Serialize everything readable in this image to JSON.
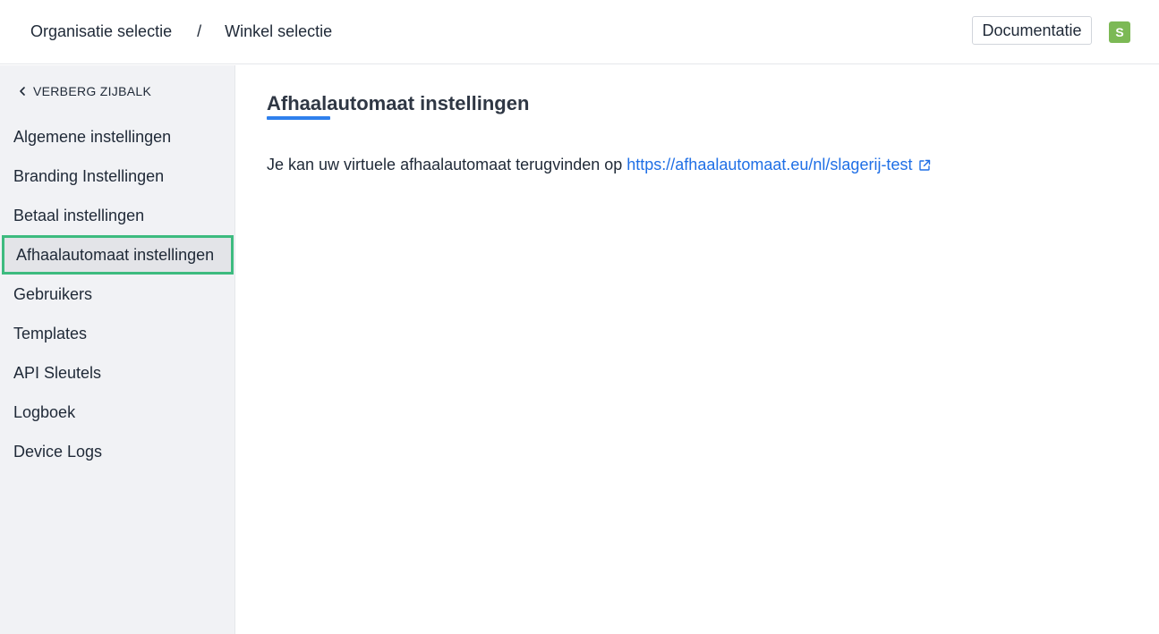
{
  "header": {
    "breadcrumb": [
      "Organisatie selectie",
      "Winkel selectie"
    ],
    "separator": "/",
    "documentation_label": "Documentatie",
    "avatar_initial": "S",
    "avatar_color": "#7cb955"
  },
  "sidebar": {
    "hide_label": "VERBERG ZIJBALK",
    "items": [
      {
        "label": "Algemene instellingen"
      },
      {
        "label": "Branding Instellingen"
      },
      {
        "label": "Betaal instellingen"
      },
      {
        "label": "Afhaalautomaat instellingen",
        "active": true
      },
      {
        "label": "Gebruikers"
      },
      {
        "label": "Templates"
      },
      {
        "label": "API Sleutels"
      },
      {
        "label": "Logboek"
      },
      {
        "label": "Device Logs"
      }
    ]
  },
  "main": {
    "title": "Afhaalautomaat instellingen",
    "text": "Je kan uw virtuele afhaalautomaat terugvinden op",
    "link": "https://afhaalautomaat.eu/nl/slagerij-test"
  },
  "colors": {
    "accent": "#2f80ed",
    "link": "#1f6fe6",
    "active_border": "#3dbb7f",
    "sidebar_bg": "#f1f2f5"
  },
  "icons": {
    "hide_sidebar": "chevron-left-icon",
    "external_link": "external-link-icon"
  }
}
